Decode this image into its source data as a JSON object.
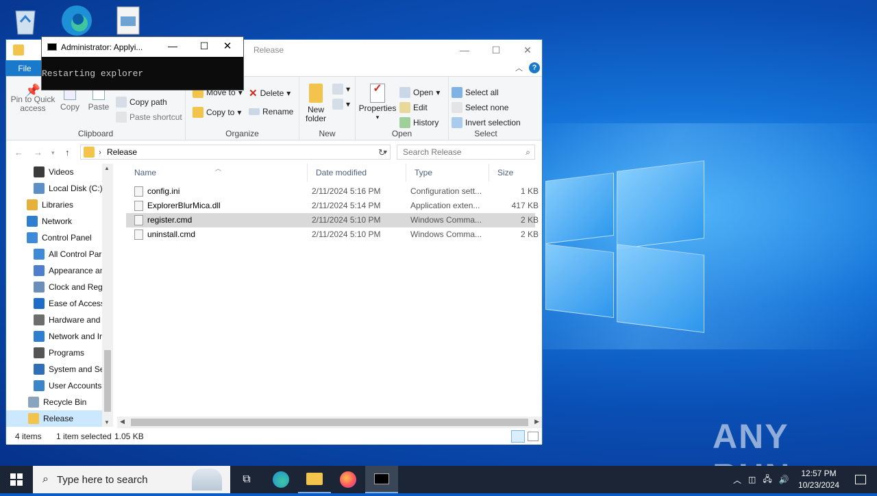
{
  "explorer": {
    "title": "Release",
    "file_tab": "File",
    "ribbon": {
      "clipboard": {
        "label": "Clipboard",
        "pin": "Pin to Quick access",
        "copy": "Copy",
        "paste": "Paste",
        "copy_path": "Copy path",
        "paste_shortcut": "Paste shortcut"
      },
      "organize": {
        "label": "Organize",
        "move_to": "Move to",
        "copy_to": "Copy to",
        "delete": "Delete",
        "rename": "Rename"
      },
      "new": {
        "label": "New",
        "new_folder": "New folder"
      },
      "open": {
        "label": "Open",
        "properties": "Properties",
        "open": "Open",
        "edit": "Edit",
        "history": "History"
      },
      "select": {
        "label": "Select",
        "select_all": "Select all",
        "select_none": "Select none",
        "invert": "Invert selection"
      }
    },
    "address": {
      "path": "Release",
      "search_placeholder": "Search Release"
    },
    "nav_items": [
      {
        "label": "Videos",
        "icon": "video-folder-icon",
        "color": "#3b3b3b"
      },
      {
        "label": "Local Disk (C:)",
        "icon": "disk-icon",
        "color": "#5a8fc8"
      },
      {
        "label": "Libraries",
        "icon": "libraries-icon",
        "color": "#e6b13a"
      },
      {
        "label": "Network",
        "icon": "network-icon",
        "color": "#2f7fd0"
      },
      {
        "label": "Control Panel",
        "icon": "control-panel-icon",
        "color": "#3f8ad6"
      },
      {
        "label": "All Control Par",
        "icon": "control-panel-icon",
        "color": "#3f8ad6"
      },
      {
        "label": "Appearance an",
        "icon": "appearance-icon",
        "color": "#4e7fcf"
      },
      {
        "label": "Clock and Regi",
        "icon": "clock-icon",
        "color": "#6b8fb8"
      },
      {
        "label": "Ease of Access",
        "icon": "ease-of-access-icon",
        "color": "#1e6ec9"
      },
      {
        "label": "Hardware and",
        "icon": "printer-icon",
        "color": "#6d6d6d"
      },
      {
        "label": "Network and Ir",
        "icon": "network-icon",
        "color": "#2f7fd0"
      },
      {
        "label": "Programs",
        "icon": "programs-icon",
        "color": "#555555"
      },
      {
        "label": "System and Se",
        "icon": "shield-icon",
        "color": "#2f6fb8"
      },
      {
        "label": "User Accounts",
        "icon": "users-icon",
        "color": "#3b86c9"
      },
      {
        "label": "Recycle Bin",
        "icon": "recycle-bin-icon",
        "color": "#8aa4bd"
      },
      {
        "label": "Release",
        "icon": "folder-icon",
        "color": "#f2c44b"
      }
    ],
    "columns": {
      "name": "Name",
      "date": "Date modified",
      "type": "Type",
      "size": "Size"
    },
    "files": [
      {
        "name": "config.ini",
        "date": "2/11/2024 5:16 PM",
        "type": "Configuration sett...",
        "size": "1 KB"
      },
      {
        "name": "ExplorerBlurMica.dll",
        "date": "2/11/2024 5:14 PM",
        "type": "Application exten...",
        "size": "417 KB"
      },
      {
        "name": "register.cmd",
        "date": "2/11/2024 5:10 PM",
        "type": "Windows Comma...",
        "size": "2 KB"
      },
      {
        "name": "uninstall.cmd",
        "date": "2/11/2024 5:10 PM",
        "type": "Windows Comma...",
        "size": "2 KB"
      }
    ],
    "status": {
      "count": "4 items",
      "selected": "1 item selected",
      "size": "1.05 KB"
    }
  },
  "cmd": {
    "title": "Administrator:  Applyi...",
    "output": "Restarting explorer"
  },
  "taskbar": {
    "search_placeholder": "Type here to search",
    "time": "12:57 PM",
    "date": "10/23/2024"
  },
  "watermark": "ANY RUN",
  "colors": {
    "accent": "#1979ca",
    "selection": "#cce8ff",
    "taskbar": "#1b2535"
  }
}
